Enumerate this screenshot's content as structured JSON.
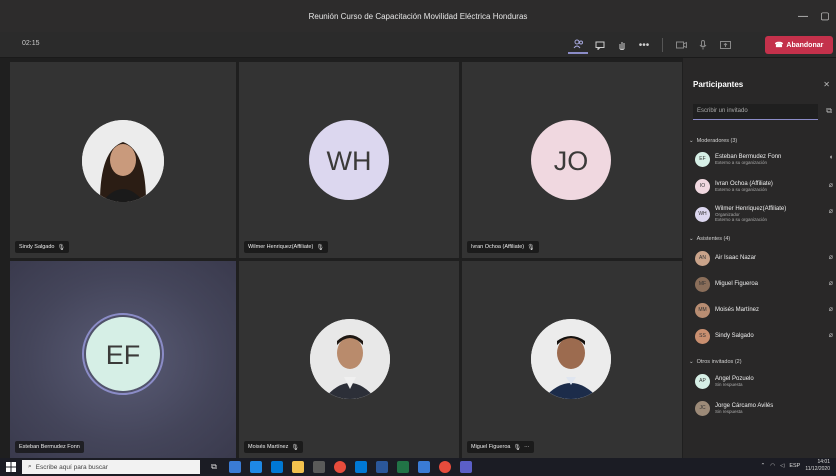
{
  "window": {
    "title": "Reunión Curso de Capacitación Movilidad Eléctrica Honduras",
    "controls": [
      "—",
      "▢"
    ]
  },
  "toolbar": {
    "timer": "02:15",
    "leave_label": "Abandonar"
  },
  "tiles": [
    {
      "name": "Sindy Salgado",
      "type": "photo"
    },
    {
      "name": "Wilmer Henriquez(Affiliate)",
      "type": "initials",
      "initials": "WH",
      "avatar_color": "#dcd7ef"
    },
    {
      "name": "Ivran Ochoa (Affiliate)",
      "type": "initials",
      "initials": "JO",
      "avatar_color": "#f0d8e0"
    },
    {
      "name": "Esteban Bermudez Fonn",
      "type": "initials",
      "initials": "EF",
      "avatar_color": "#d6efe6"
    },
    {
      "name": "Moisés Martínez",
      "type": "photo"
    },
    {
      "name": "Miguel Figueroa",
      "type": "photo"
    }
  ],
  "panel": {
    "title": "Participantes",
    "search_placeholder": "Escribir un invitado",
    "sections": [
      {
        "label": "Moderadores (3)",
        "items": [
          {
            "name": "Esteban Bermudez Fonn",
            "sub": "Externo a su organización",
            "initials": "EF"
          },
          {
            "name": "Ivran Ochoa (Affiliate)",
            "sub": "Externo a su organización",
            "initials": "IO"
          },
          {
            "name": "Wilmer Henriquez(Affiliate)",
            "sub": "Organizador",
            "sub2": "Externo a su organización",
            "initials": "WH"
          }
        ]
      },
      {
        "label": "Asistentes (4)",
        "items": [
          {
            "name": "Air Isaac Nazar",
            "sub": "",
            "initials": "AN"
          },
          {
            "name": "Miguel Figueroa",
            "sub": "",
            "initials": "MF"
          },
          {
            "name": "Moisés Martínez",
            "sub": "",
            "initials": "MM"
          },
          {
            "name": "Sindy Salgado",
            "sub": "",
            "initials": "SS"
          }
        ]
      },
      {
        "label": "Otros invitados (2)",
        "items": [
          {
            "name": "Angel Pozuelo",
            "sub": "Sin respuesta",
            "initials": "AP"
          },
          {
            "name": "Jorge Cárcamo Avilés",
            "sub": "Sin respuesta",
            "initials": "JC"
          }
        ]
      }
    ]
  },
  "taskbar": {
    "search_placeholder": "Escribe aquí para buscar",
    "lang": "ESP",
    "time": "14:01",
    "date": "11/12/2020"
  }
}
